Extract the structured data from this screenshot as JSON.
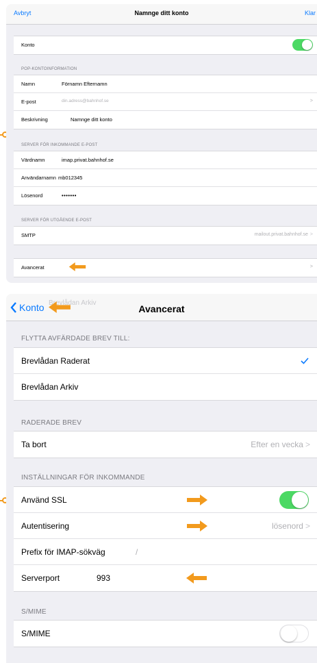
{
  "top": {
    "nav": {
      "cancel": "Avbryt",
      "title": "Namnge ditt konto",
      "done": "Klar"
    },
    "account_label": "Konto",
    "account_on": true,
    "pop_header": "POP-KONTOINFORMATION",
    "name_label": "Namn",
    "name_value": "Förnamn Efternamn",
    "email_label": "E-post",
    "email_placeholder": "din.adress@bahnhof.se",
    "desc_label": "Beskrivning",
    "desc_value": "Namnge ditt konto",
    "incoming_header": "SERVER FÖR INKOMMANDE E-POST",
    "host_label": "Värdnamn",
    "host_value": "imap.privat.bahnhof.se",
    "user_label": "Användarnamn",
    "user_value": "mb012345",
    "pass_label": "Lösenord",
    "pass_value": "•••••••",
    "outgoing_header": "SERVER FÖR UTGÅENDE E-POST",
    "smtp_label": "SMTP",
    "smtp_value": "mailout.privat.bahnhof.se",
    "advanced_label": "Avancerat"
  },
  "bottom": {
    "nav": {
      "back": "Konto",
      "title": "Avancerat",
      "ghost": "Brevlådan Arkiv"
    },
    "move_header": "FLYTTA AVFÄRDADE BREV TILL:",
    "mailbox_deleted": "Brevlådan Raderat",
    "mailbox_archive": "Brevlådan Arkiv",
    "deleted_header": "RADERADE BREV",
    "remove_label": "Ta bort",
    "remove_value": "Efter en vecka",
    "incoming_header": "INSTÄLLNINGAR FÖR INKOMMANDE",
    "ssl_label": "Använd SSL",
    "ssl_on": true,
    "auth_label": "Autentisering",
    "auth_value": "lösenord",
    "prefix_label": "Prefix för IMAP-sökväg",
    "prefix_value": "/",
    "port_label": "Serverport",
    "port_value": "993",
    "smime_header": "S/MIME",
    "smime_label": "S/MIME",
    "smime_on": false
  },
  "colors": {
    "accent": "#0a7aff",
    "toggle_on": "#4cd964",
    "annotation": "#f29a1d"
  }
}
